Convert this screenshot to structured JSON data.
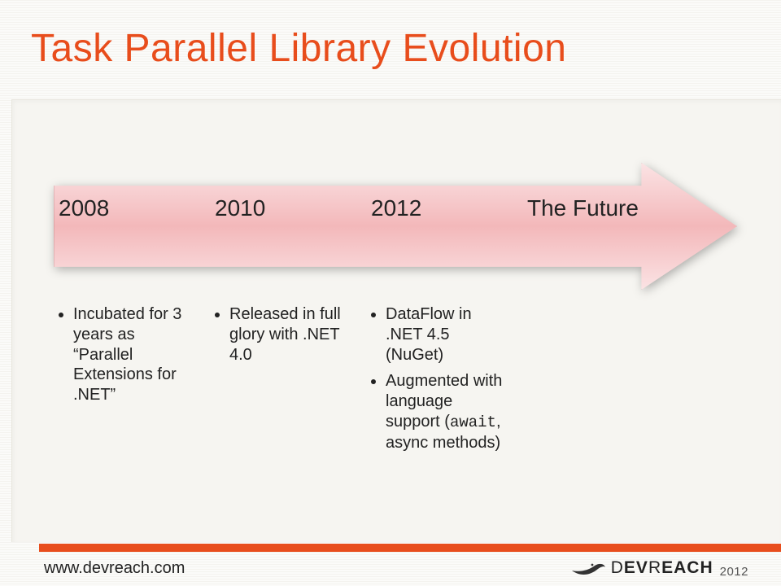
{
  "title": "Task Parallel Library Evolution",
  "columns": [
    {
      "head": "2008",
      "bullets": [
        "Incubated for 3 years as “Parallel Extensions for .NET”"
      ]
    },
    {
      "head": "2010",
      "bullets": [
        "Released in full glory with .NET 4.0"
      ]
    },
    {
      "head": "2012",
      "bullets": [
        "DataFlow in .NET 4.5 (NuGet)",
        "Augmented with language support (await, async methods)"
      ],
      "code_token": "await"
    },
    {
      "head": "The Future",
      "bullets": []
    }
  ],
  "footer": {
    "url": "www.devreach.com",
    "brand_light": "D",
    "brand_bold_1": "EV",
    "brand_light_2": "R",
    "brand_bold_2": "EACH",
    "year": "2012"
  }
}
